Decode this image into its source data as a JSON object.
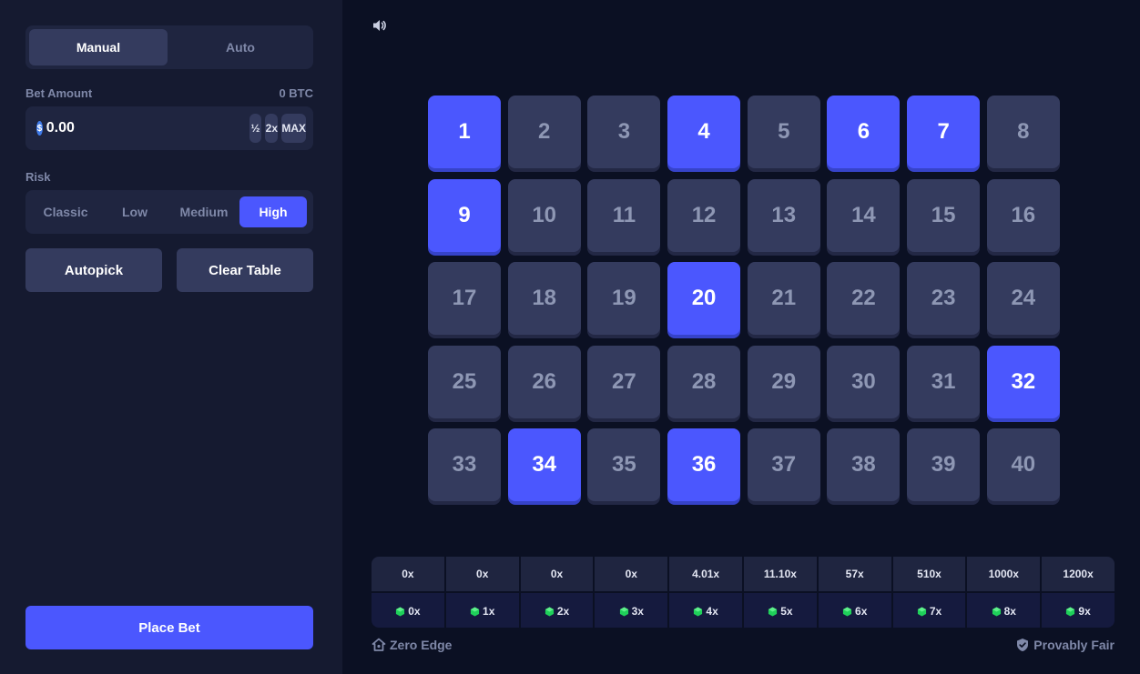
{
  "sidebar": {
    "mode_tabs": [
      {
        "label": "Manual",
        "active": true
      },
      {
        "label": "Auto",
        "active": false
      }
    ],
    "bet_amount": {
      "label": "Bet Amount",
      "balance": "0 BTC",
      "currency_symbol": "$",
      "value": "0.00",
      "half_label": "½",
      "double_label": "2x",
      "max_label": "MAX"
    },
    "risk": {
      "label": "Risk",
      "options": [
        {
          "label": "Classic",
          "active": false
        },
        {
          "label": "Low",
          "active": false
        },
        {
          "label": "Medium",
          "active": false
        },
        {
          "label": "High",
          "active": true
        }
      ]
    },
    "autopick_label": "Autopick",
    "clear_table_label": "Clear Table",
    "place_bet_label": "Place Bet"
  },
  "board": {
    "tiles": [
      {
        "n": "1",
        "selected": true
      },
      {
        "n": "2",
        "selected": false
      },
      {
        "n": "3",
        "selected": false
      },
      {
        "n": "4",
        "selected": true
      },
      {
        "n": "5",
        "selected": false
      },
      {
        "n": "6",
        "selected": true
      },
      {
        "n": "7",
        "selected": true
      },
      {
        "n": "8",
        "selected": false
      },
      {
        "n": "9",
        "selected": true
      },
      {
        "n": "10",
        "selected": false
      },
      {
        "n": "11",
        "selected": false
      },
      {
        "n": "12",
        "selected": false
      },
      {
        "n": "13",
        "selected": false
      },
      {
        "n": "14",
        "selected": false
      },
      {
        "n": "15",
        "selected": false
      },
      {
        "n": "16",
        "selected": false
      },
      {
        "n": "17",
        "selected": false
      },
      {
        "n": "18",
        "selected": false
      },
      {
        "n": "19",
        "selected": false
      },
      {
        "n": "20",
        "selected": true
      },
      {
        "n": "21",
        "selected": false
      },
      {
        "n": "22",
        "selected": false
      },
      {
        "n": "23",
        "selected": false
      },
      {
        "n": "24",
        "selected": false
      },
      {
        "n": "25",
        "selected": false
      },
      {
        "n": "26",
        "selected": false
      },
      {
        "n": "27",
        "selected": false
      },
      {
        "n": "28",
        "selected": false
      },
      {
        "n": "29",
        "selected": false
      },
      {
        "n": "30",
        "selected": false
      },
      {
        "n": "31",
        "selected": false
      },
      {
        "n": "32",
        "selected": true
      },
      {
        "n": "33",
        "selected": false
      },
      {
        "n": "34",
        "selected": true
      },
      {
        "n": "35",
        "selected": false
      },
      {
        "n": "36",
        "selected": true
      },
      {
        "n": "37",
        "selected": false
      },
      {
        "n": "38",
        "selected": false
      },
      {
        "n": "39",
        "selected": false
      },
      {
        "n": "40",
        "selected": false
      }
    ]
  },
  "paytable": {
    "multipliers": [
      "0x",
      "0x",
      "0x",
      "0x",
      "4.01x",
      "11.10x",
      "57x",
      "510x",
      "1000x",
      "1200x"
    ],
    "hits": [
      "0x",
      "1x",
      "2x",
      "3x",
      "4x",
      "5x",
      "6x",
      "7x",
      "8x",
      "9x"
    ]
  },
  "footer": {
    "zero_edge_label": "Zero Edge",
    "provably_fair_label": "Provably Fair"
  },
  "colors": {
    "accent": "#4b57fe",
    "tile": "#343b5e",
    "sidebar": "#151a30",
    "background": "#0b1023",
    "gem": "#1fd05a"
  },
  "icons": {
    "sound": "speaker-icon",
    "coin": "dollar-coin-icon",
    "gem": "gem-icon",
    "zero_edge": "house-icon",
    "provably_fair": "shield-check-icon"
  }
}
